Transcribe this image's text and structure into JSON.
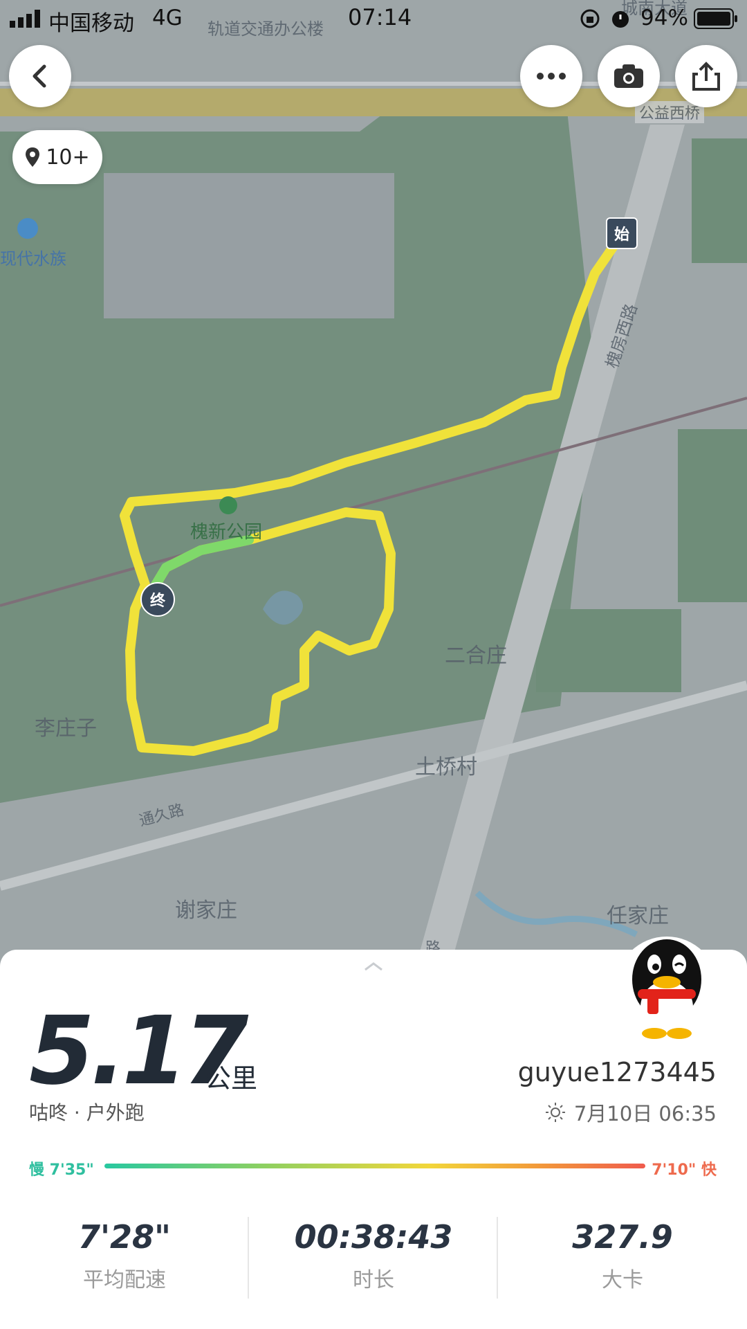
{
  "status_bar": {
    "carrier": "中国移动",
    "network": "4G",
    "time": "07:14",
    "battery": "94%"
  },
  "map": {
    "labels": [
      "轨道交通办公楼",
      "城南大道",
      "公益西桥",
      "现代水族",
      "槐房西路",
      "槐新公园",
      "二合庄",
      "李庄子",
      "土桥村",
      "通久路",
      "谢家庄",
      "任家庄",
      "路"
    ],
    "marker_start": "始",
    "marker_end": "终"
  },
  "location_count": "10+",
  "icons": {
    "back": "back-arrow-icon",
    "more": "more-icon",
    "camera": "camera-icon",
    "share": "share-icon",
    "location": "location-pin-icon",
    "weather": "sun-icon",
    "avatar": "penguin-avatar-icon"
  },
  "summary": {
    "distance": "5.17",
    "unit": "公里",
    "source": "咕咚 · 户外跑",
    "username": "guyue1273445",
    "datetime": "7月10日 06:35"
  },
  "pace_legend": {
    "slow": "慢 7'35\"",
    "fast": "7'10\" 快"
  },
  "stats": [
    {
      "value": "7'28\"",
      "label": "平均配速"
    },
    {
      "value": "00:38:43",
      "label": "时长"
    },
    {
      "value": "327.9",
      "label": "大卡"
    }
  ],
  "colors": {
    "route": "#f0e23a",
    "route_fast": "#7fd96a",
    "pace_slow": "#2fbf9f",
    "pace_fast": "#ee6a4d"
  }
}
